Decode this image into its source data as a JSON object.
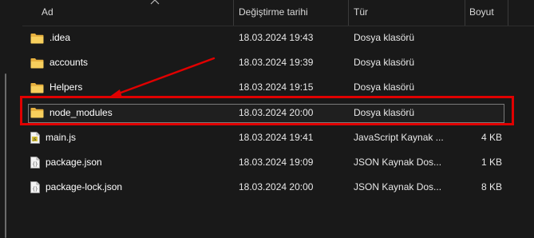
{
  "header": {
    "name_label": "Ad",
    "date_label": "Değiştirme tarihi",
    "type_label": "Tür",
    "size_label": "Boyut"
  },
  "rows": [
    {
      "name": ".idea",
      "date": "18.03.2024 19:43",
      "type": "Dosya klasörü",
      "size": "",
      "icon": "folder-icon"
    },
    {
      "name": "accounts",
      "date": "18.03.2024 19:39",
      "type": "Dosya klasörü",
      "size": "",
      "icon": "folder-icon"
    },
    {
      "name": "Helpers",
      "date": "18.03.2024 19:15",
      "type": "Dosya klasörü",
      "size": "",
      "icon": "folder-icon"
    },
    {
      "name": "node_modules",
      "date": "18.03.2024 20:00",
      "type": "Dosya klasörü",
      "size": "",
      "icon": "folder-icon"
    },
    {
      "name": "main.js",
      "date": "18.03.2024 19:41",
      "type": "JavaScript Kaynak ...",
      "size": "4 KB",
      "icon": "js-file-icon"
    },
    {
      "name": "package.json",
      "date": "18.03.2024 19:09",
      "type": "JSON Kaynak Dos...",
      "size": "1 KB",
      "icon": "json-file-icon"
    },
    {
      "name": "package-lock.json",
      "date": "18.03.2024 20:00",
      "type": "JSON Kaynak Dos...",
      "size": "8 KB",
      "icon": "json-file-icon"
    }
  ],
  "colors": {
    "background": "#191919",
    "folder": "#f2c14e",
    "annotation": "#e00000"
  }
}
